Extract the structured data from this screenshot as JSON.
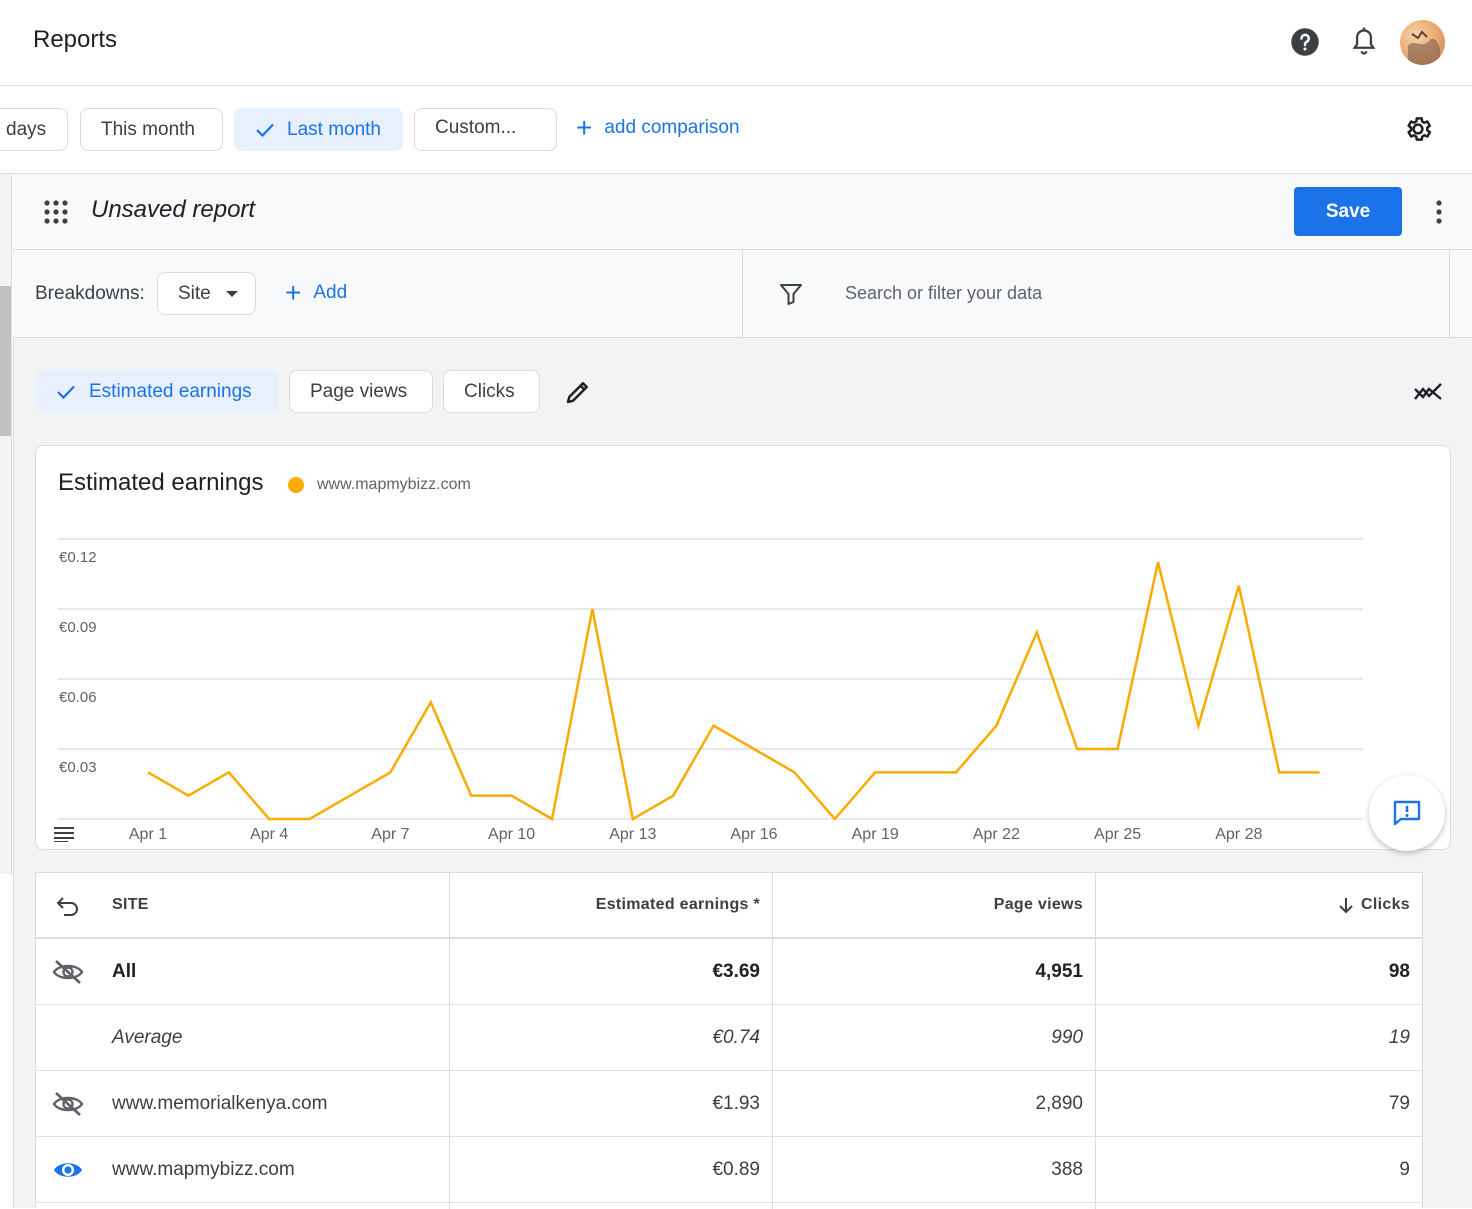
{
  "header": {
    "title": "Reports"
  },
  "date_filters": {
    "chips": [
      {
        "label": "days",
        "selected": false
      },
      {
        "label": "This month",
        "selected": false
      },
      {
        "label": "Last month",
        "selected": true
      },
      {
        "label": "Custom...",
        "selected": false
      }
    ],
    "add_comparison": "add comparison"
  },
  "report": {
    "name": "Unsaved report",
    "save_label": "Save"
  },
  "breakdowns": {
    "label": "Breakdowns:",
    "selected": "Site",
    "add_label": "Add",
    "search_placeholder": "Search or filter your data"
  },
  "metrics": {
    "chips": [
      {
        "label": "Estimated earnings",
        "selected": true
      },
      {
        "label": "Page views",
        "selected": false
      },
      {
        "label": "Clicks",
        "selected": false
      }
    ]
  },
  "chart_data": {
    "type": "line",
    "title": "Estimated earnings",
    "legend_position": "top-left",
    "grid": true,
    "series": [
      {
        "name": "www.mapmybizz.com",
        "color": "#F9AB00",
        "x": [
          "Apr 1",
          "Apr 2",
          "Apr 3",
          "Apr 4",
          "Apr 5",
          "Apr 6",
          "Apr 7",
          "Apr 8",
          "Apr 9",
          "Apr 10",
          "Apr 11",
          "Apr 12",
          "Apr 13",
          "Apr 14",
          "Apr 15",
          "Apr 16",
          "Apr 17",
          "Apr 18",
          "Apr 19",
          "Apr 20",
          "Apr 21",
          "Apr 22",
          "Apr 23",
          "Apr 24",
          "Apr 25",
          "Apr 26",
          "Apr 27",
          "Apr 28",
          "Apr 29",
          "Apr 30"
        ],
        "values": [
          0.02,
          0.01,
          0.02,
          0,
          0,
          0.01,
          0.02,
          0.05,
          0.01,
          0.01,
          0,
          0.09,
          0,
          0.01,
          0.04,
          0.03,
          0.02,
          0,
          0.02,
          0.02,
          0.02,
          0.04,
          0.08,
          0.03,
          0.03,
          0.11,
          0.04,
          0.1,
          0.02,
          0.02
        ]
      }
    ],
    "x_tick_labels": [
      "Apr 1",
      "Apr 4",
      "Apr 7",
      "Apr 10",
      "Apr 13",
      "Apr 16",
      "Apr 19",
      "Apr 22",
      "Apr 25",
      "Apr 28"
    ],
    "y_ticks": [
      0.03,
      0.06,
      0.09,
      0.12
    ],
    "y_tick_labels": [
      "€0.03",
      "€0.06",
      "€0.09",
      "€0.12"
    ],
    "ylim": [
      0,
      0.12
    ]
  },
  "table": {
    "columns": [
      "SITE",
      "Estimated earnings *",
      "Page views",
      "Clicks"
    ],
    "rows": [
      {
        "site": "All",
        "earnings": "€3.69",
        "page_views": "4,951",
        "clicks": "98",
        "style": "bold",
        "icon": "visibility-off-icon"
      },
      {
        "site": "Average",
        "earnings": "€0.74",
        "page_views": "990",
        "clicks": "19",
        "style": "italic",
        "icon": ""
      },
      {
        "site": "www.memorialkenya.com",
        "earnings": "€1.93",
        "page_views": "2,890",
        "clicks": "79",
        "style": "normal",
        "icon": "visibility-off-icon"
      },
      {
        "site": "www.mapmybizz.com",
        "earnings": "€0.89",
        "page_views": "388",
        "clicks": "9",
        "style": "normal",
        "icon": "visibility-icon"
      }
    ]
  },
  "colors": {
    "accent": "#1a73e8",
    "series": "#F9AB00"
  }
}
